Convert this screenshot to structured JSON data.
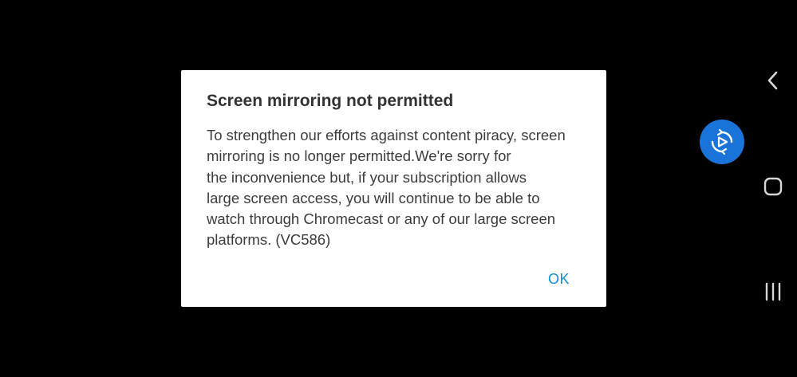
{
  "dialog": {
    "title": "Screen mirroring not permitted",
    "message_lines": [
      "To strengthen our efforts against content piracy, screen",
      "mirroring is no longer permitted.We're sorry for",
      "the inconvenience but, if your subscription allows",
      "large screen access, you will continue to be able to",
      "watch through Chromecast or any of our large screen",
      "platforms. (VC586)"
    ],
    "ok_label": "OK"
  },
  "floating_button": {
    "icon": "screen-rotate-icon",
    "color": "#1a73d9"
  },
  "nav_bar": {
    "back_icon": "chevron-left-icon",
    "home_icon": "rounded-square-home-icon",
    "recents_icon": "recents-lines-icon"
  },
  "colors": {
    "background": "#000000",
    "dialog_bg": "#ffffff",
    "accent": "#0a91d4"
  }
}
